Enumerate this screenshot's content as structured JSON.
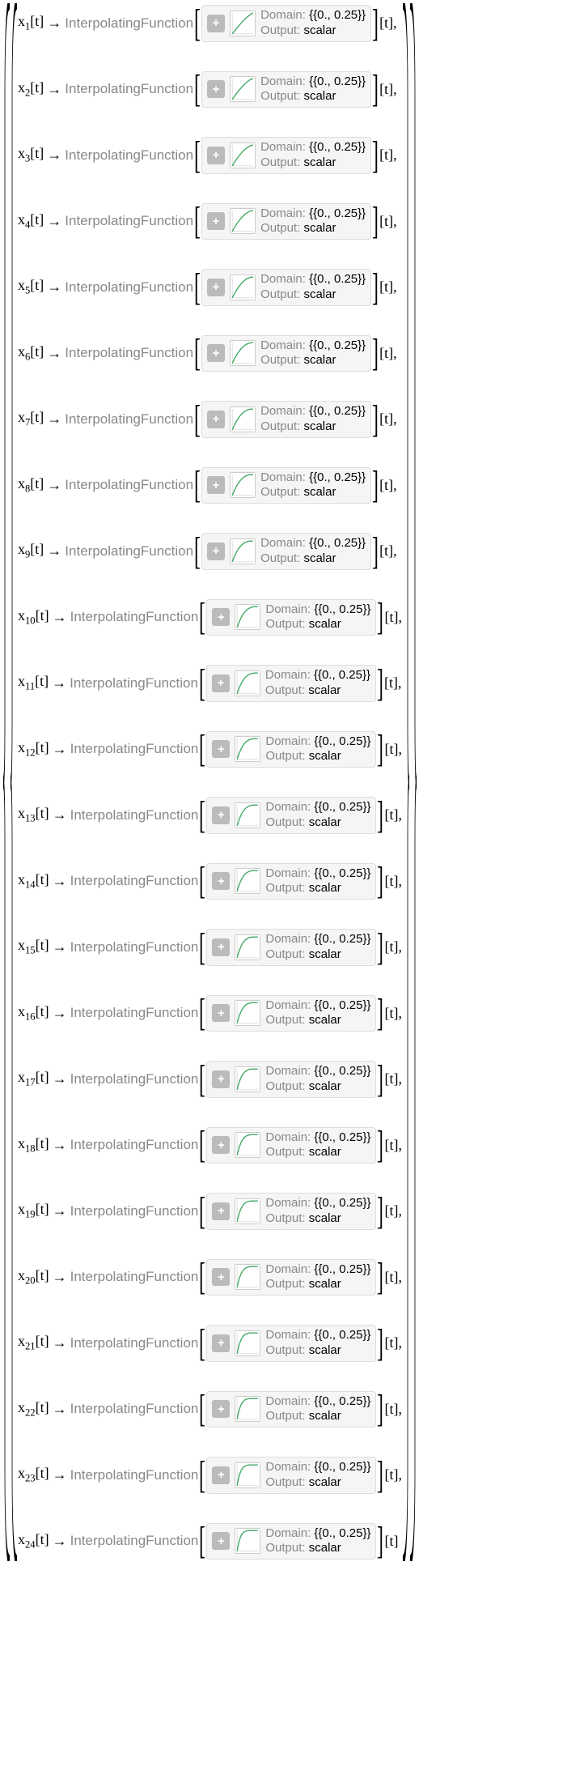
{
  "func_name": "InterpolatingFunction",
  "domain_label": "Domain: ",
  "domain_value": "{{0., 0.25}}",
  "output_label": "Output: ",
  "output_value": "scalar",
  "arrow": "→",
  "arg": "[t]",
  "expand": "+",
  "rows": [
    {
      "id": "x1",
      "var": "x",
      "sub": "1",
      "curve": 0.05,
      "last": false
    },
    {
      "id": "x2",
      "var": "x",
      "sub": "2",
      "curve": 0.08,
      "last": false
    },
    {
      "id": "x3",
      "var": "x",
      "sub": "3",
      "curve": 0.11,
      "last": false
    },
    {
      "id": "x4",
      "var": "x",
      "sub": "4",
      "curve": 0.14,
      "last": false
    },
    {
      "id": "x5",
      "var": "x",
      "sub": "5",
      "curve": 0.17,
      "last": false
    },
    {
      "id": "x6",
      "var": "x",
      "sub": "6",
      "curve": 0.2,
      "last": false
    },
    {
      "id": "x7",
      "var": "x",
      "sub": "7",
      "curve": 0.23,
      "last": false
    },
    {
      "id": "x8",
      "var": "x",
      "sub": "8",
      "curve": 0.26,
      "last": false
    },
    {
      "id": "x9",
      "var": "x",
      "sub": "9",
      "curve": 0.29,
      "last": false
    },
    {
      "id": "x10",
      "var": "x",
      "sub": "10",
      "curve": 0.32,
      "last": false
    },
    {
      "id": "x11",
      "var": "x",
      "sub": "11",
      "curve": 0.35,
      "last": false
    },
    {
      "id": "x12",
      "var": "x",
      "sub": "12",
      "curve": 0.38,
      "last": false
    },
    {
      "id": "x13",
      "var": "x",
      "sub": "13",
      "curve": 0.41,
      "last": false
    },
    {
      "id": "x14",
      "var": "x",
      "sub": "14",
      "curve": 0.44,
      "last": false
    },
    {
      "id": "x15",
      "var": "x",
      "sub": "15",
      "curve": 0.47,
      "last": false
    },
    {
      "id": "x16",
      "var": "x",
      "sub": "16",
      "curve": 0.5,
      "last": false
    },
    {
      "id": "x17",
      "var": "x",
      "sub": "17",
      "curve": 0.54,
      "last": false
    },
    {
      "id": "x18",
      "var": "x",
      "sub": "18",
      "curve": 0.58,
      "last": false
    },
    {
      "id": "x19",
      "var": "x",
      "sub": "19",
      "curve": 0.62,
      "last": false
    },
    {
      "id": "x20",
      "var": "x",
      "sub": "20",
      "curve": 0.66,
      "last": false
    },
    {
      "id": "x21",
      "var": "x",
      "sub": "21",
      "curve": 0.72,
      "last": false
    },
    {
      "id": "x22",
      "var": "x",
      "sub": "22",
      "curve": 0.78,
      "last": false
    },
    {
      "id": "x23",
      "var": "x",
      "sub": "23",
      "curve": 0.84,
      "last": false
    },
    {
      "id": "x24",
      "var": "x",
      "sub": "24",
      "curve": 0.9,
      "last": true
    }
  ]
}
